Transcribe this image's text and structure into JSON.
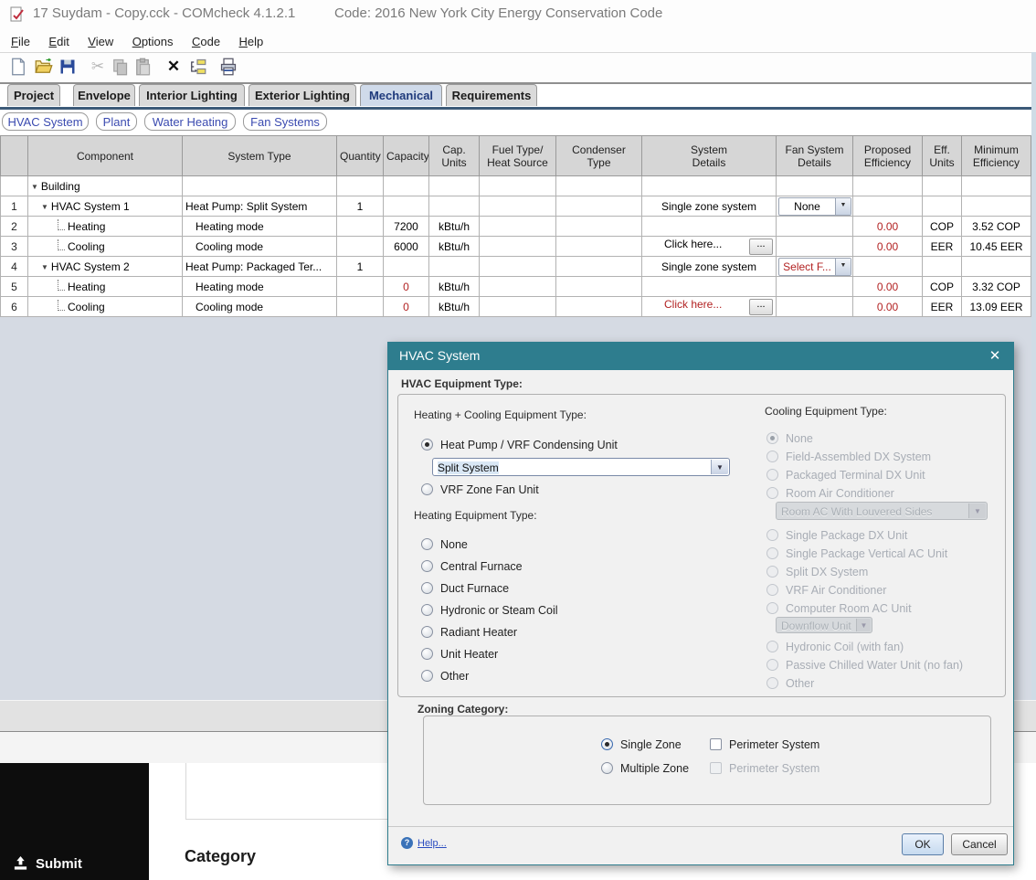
{
  "window": {
    "title": "17 Suydam - Copy.cck - COMcheck 4.1.2.1",
    "code_label": "Code: 2016 New York City Energy Conservation Code"
  },
  "menu": [
    {
      "key": "F",
      "rest": "ile"
    },
    {
      "key": "E",
      "rest": "dit"
    },
    {
      "key": "V",
      "rest": "iew"
    },
    {
      "key": "O",
      "rest": "ptions"
    },
    {
      "key": "C",
      "rest": "ode"
    },
    {
      "key": "H",
      "rest": "elp"
    }
  ],
  "toolbar": {
    "icons": [
      "new-file-icon",
      "open-file-icon",
      "save-icon",
      "cut-icon",
      "copy-icon",
      "paste-icon",
      "delete-icon",
      "transfer-icon",
      "print-icon"
    ],
    "delete_glyph": "✕",
    "cut_glyph": "✂"
  },
  "tabs": [
    {
      "label": "Project",
      "active": false
    },
    {
      "label": "Envelope",
      "active": false
    },
    {
      "label": "Interior Lighting",
      "active": false
    },
    {
      "label": "Exterior Lighting",
      "active": false
    },
    {
      "label": "Mechanical",
      "active": true
    },
    {
      "label": "Requirements",
      "active": false
    }
  ],
  "subtabs": [
    "HVAC System",
    "Plant",
    "Water Heating",
    "Fan Systems"
  ],
  "table": {
    "headers": [
      "",
      "Component",
      "System Type",
      "Quantity",
      "Capacity",
      "Cap.\nUnits",
      "Fuel Type/\nHeat Source",
      "Condenser\nType",
      "System\nDetails",
      "Fan System\nDetails",
      "Proposed\nEfficiency",
      "Eff.\nUnits",
      "Minimum\nEfficiency"
    ],
    "ellipsis": "...",
    "rows": [
      {
        "num": "",
        "component": "Building"
      },
      {
        "num": "1",
        "component": "HVAC System 1",
        "system_type": "Heat Pump: Split System",
        "quantity": "1",
        "system_details": "Single zone system",
        "fan_details": "None"
      },
      {
        "num": "2",
        "component": "Heating",
        "system_type": "Heating mode",
        "capacity": "7200",
        "cap_units": "kBtu/h",
        "proposed_eff": "0.00",
        "eff_units": "COP",
        "min_eff": "3.52 COP"
      },
      {
        "num": "3",
        "component": "Cooling",
        "system_type": "Cooling mode",
        "capacity": "6000",
        "cap_units": "kBtu/h",
        "system_details": "Click here...",
        "proposed_eff": "0.00",
        "eff_units": "EER",
        "min_eff": "10.45 EER"
      },
      {
        "num": "4",
        "component": "HVAC System 2",
        "system_type": "Heat Pump: Packaged Ter...",
        "quantity": "1",
        "system_details": "Single zone system",
        "fan_details": "Select F...",
        "quantity2": "1"
      },
      {
        "num": "5",
        "component": "Heating",
        "system_type": "Heating mode",
        "capacity": "0",
        "cap_units": "kBtu/h",
        "proposed_eff": "0.00",
        "eff_units": "COP",
        "min_eff": "3.32 COP"
      },
      {
        "num": "6",
        "component": "Cooling",
        "system_type": "Cooling mode",
        "capacity": "0",
        "cap_units": "kBtu/h",
        "system_details": "Click here...",
        "proposed_eff": "0.00",
        "eff_units": "EER",
        "min_eff": "13.09 EER"
      }
    ]
  },
  "dialog": {
    "title": "HVAC System",
    "equipment_group_label": "HVAC Equipment Type:",
    "heating_cooling_label": "Heating + Cooling Equipment Type:",
    "heat_pump_option": "Heat Pump / VRF Condensing Unit",
    "heat_pump_combo_value": "Split System",
    "vrf_option": "VRF Zone Fan Unit",
    "heating_label": "Heating Equipment Type:",
    "heating_options": [
      "None",
      "Central Furnace",
      "Duct Furnace",
      "Hydronic or Steam Coil",
      "Radiant Heater",
      "Unit Heater",
      "Other"
    ],
    "cooling_label": "Cooling Equipment Type:",
    "cooling_options_top": [
      "None",
      "Field-Assembled DX System",
      "Packaged Terminal DX Unit",
      "Room Air Conditioner"
    ],
    "room_ac_combo_value": "Room AC With Louvered Sides",
    "cooling_options_mid": [
      "Single Package DX Unit",
      "Single Package Vertical AC Unit",
      "Split DX System",
      "VRF Air Conditioner",
      "Computer Room AC Unit"
    ],
    "computer_room_combo_value": "Downflow Unit",
    "cooling_options_bottom": [
      "Hydronic Coil (with fan)",
      "Passive Chilled Water Unit (no fan)",
      "Other"
    ],
    "zoning_label": "Zoning Category:",
    "single_zone_label": "Single Zone",
    "multiple_zone_label": "Multiple Zone",
    "perimeter_system_1": "Perimeter System",
    "perimeter_system_2": "Perimeter System",
    "help_label": "Help...",
    "ok_label": "OK",
    "cancel_label": "Cancel"
  },
  "bottom": {
    "submit_label": "Submit",
    "category_label": "Category"
  },
  "colors": {
    "dialog_titlebar_teal": "#2e7d8e",
    "selection_blue": "#a9d2f4",
    "alert_red": "#b22222",
    "link_blue": "#3b4bb0",
    "tab_underline": "#3c5a78"
  }
}
